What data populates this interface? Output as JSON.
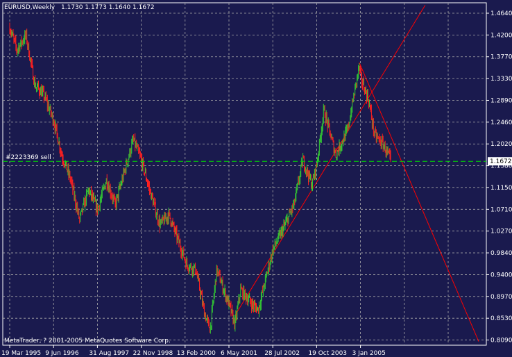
{
  "header": {
    "symbol_period": "EURUSD,Weekly",
    "ohlc": "1.1730 1.1773 1.1640 1.1672"
  },
  "order_label": "#2223369 sell",
  "current_price_label": "1.1672",
  "copyright": "MetaTrader, ? 2001-2005 MetaQuotes Software Corp.",
  "colors": {
    "background": "#1a1a4e",
    "grid": "#aaaaaa",
    "axis": "#ffffff",
    "bull": "#33cc33",
    "bear": "#ff2020",
    "order_line": "#00dd00",
    "trendlines": "#ff0000",
    "price_box_bg": "#ffffff",
    "price_box_fg": "#000000"
  },
  "chart_data": {
    "type": "line",
    "title": "EURUSD,Weekly",
    "y_tick_labels": [
      "1.4640",
      "1.4200",
      "1.3770",
      "1.3330",
      "1.2890",
      "1.2460",
      "1.2020",
      "1.1580",
      "1.1150",
      "1.0710",
      "1.0270",
      "0.9840",
      "0.9400",
      "0.8970",
      "0.8530",
      "0.8090"
    ],
    "x_tick_labels": [
      "19 Mar 1995",
      "9 Jun 1996",
      "31 Aug 1997",
      "22 Nov 1998",
      "13 Feb 2000",
      "6 May 2001",
      "28 Jul 2002",
      "19 Oct 2003",
      "3 Jan 2005"
    ],
    "ylim": [
      0.806,
      1.48
    ],
    "grid": true,
    "price_path": [
      [
        "1995-03-19",
        1.435
      ],
      [
        "1995-06-01",
        1.39
      ],
      [
        "1995-09-01",
        1.42
      ],
      [
        "1995-12-01",
        1.32
      ],
      [
        "1996-03-01",
        1.3
      ],
      [
        "1996-06-09",
        1.25
      ],
      [
        "1996-09-01",
        1.18
      ],
      [
        "1996-12-01",
        1.13
      ],
      [
        "1997-03-01",
        1.05
      ],
      [
        "1997-06-01",
        1.11
      ],
      [
        "1997-08-31",
        1.07
      ],
      [
        "1997-12-01",
        1.13
      ],
      [
        "1998-03-01",
        1.08
      ],
      [
        "1998-09-01",
        1.21
      ],
      [
        "1998-11-22",
        1.17
      ],
      [
        "1999-03-01",
        1.1
      ],
      [
        "1999-06-01",
        1.04
      ],
      [
        "1999-09-01",
        1.06
      ],
      [
        "1999-12-01",
        1.01
      ],
      [
        "2000-03-01",
        0.96
      ],
      [
        "2000-06-01",
        0.95
      ],
      [
        "2000-09-01",
        0.86
      ],
      [
        "2000-10-26",
        0.83
      ],
      [
        "2001-01-01",
        0.95
      ],
      [
        "2001-05-06",
        0.88
      ],
      [
        "2001-07-06",
        0.84
      ],
      [
        "2001-09-01",
        0.91
      ],
      [
        "2002-01-01",
        0.88
      ],
      [
        "2002-03-01",
        0.87
      ],
      [
        "2002-07-28",
        0.99
      ],
      [
        "2002-12-01",
        1.04
      ],
      [
        "2003-03-01",
        1.08
      ],
      [
        "2003-06-01",
        1.17
      ],
      [
        "2003-09-01",
        1.12
      ],
      [
        "2003-10-19",
        1.16
      ],
      [
        "2004-01-01",
        1.27
      ],
      [
        "2004-05-01",
        1.18
      ],
      [
        "2004-09-01",
        1.23
      ],
      [
        "2004-12-28",
        1.36
      ],
      [
        "2005-01-03",
        1.34
      ],
      [
        "2005-04-01",
        1.29
      ],
      [
        "2005-06-01",
        1.22
      ],
      [
        "2005-09-01",
        1.2
      ],
      [
        "2005-11-15",
        1.1672
      ]
    ],
    "trendlines": [
      {
        "from": [
          "2001-07-06",
          0.858
        ],
        "to": [
          "2006-11-01",
          1.48
        ]
      },
      {
        "from": [
          "2004-12-28",
          1.365
        ],
        "to": [
          "2008-05-01",
          0.806
        ]
      }
    ],
    "horizontal_lines": [
      {
        "label": "#2223369 sell",
        "y": 1.1672,
        "style": "dashed"
      }
    ],
    "current_price": 1.1672
  }
}
